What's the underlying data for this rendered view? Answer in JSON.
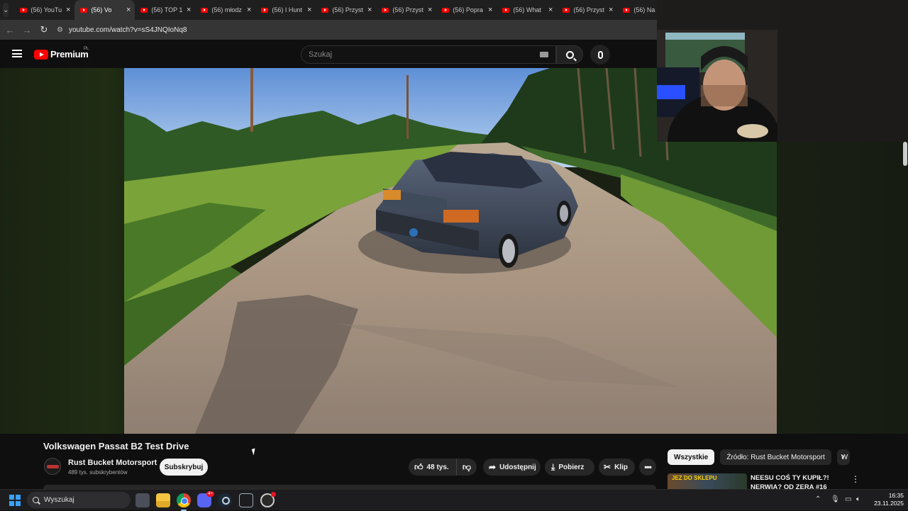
{
  "tabs": [
    {
      "title": "(56) YouTu",
      "active": false
    },
    {
      "title": "(56) Vo",
      "active": true
    },
    {
      "title": "(56) TOP 1",
      "active": false
    },
    {
      "title": "(56) młodz",
      "active": false
    },
    {
      "title": "(56) I Hunt",
      "active": false
    },
    {
      "title": "(56) Przyst",
      "active": false
    },
    {
      "title": "(56) Przyst",
      "active": false
    },
    {
      "title": "(56) Popra",
      "active": false
    },
    {
      "title": "(56) What",
      "active": false
    },
    {
      "title": "(56) Przyst",
      "active": false
    },
    {
      "title": "(56) Na",
      "active": false
    }
  ],
  "tab_close_glyph": "×",
  "address": {
    "url": "youtube.com/watch?v=sS4JNQIoNq8"
  },
  "youtube": {
    "brand": "Premium",
    "region": "PL",
    "search_placeholder": "Szukaj"
  },
  "video": {
    "title": "Volkswagen Passat B2 Test Drive",
    "channel": "Rust Bucket Motorsport",
    "subscribers": "489 tys. subskrybentów",
    "subscribe_label": "Subskrybuj",
    "likes": "48 tys.",
    "share_label": "Udostępnij",
    "download_label": "Pobierz",
    "clip_label": "Klip",
    "more_label": "•••"
  },
  "sidebar": {
    "chips": [
      "Wszystkie",
      "Źródło: Rust Bucket Motorsport",
      "W"
    ],
    "next_glyph": "›",
    "recommendation": {
      "title": "NEESU COŚ TY KUPIŁ?! NERWIA? OD ZERA #16",
      "thumb_label": "JEZ DO SKLEPU",
      "more_glyph": "⋮"
    }
  },
  "taskbar": {
    "search_placeholder": "Wyszukaj",
    "discord_badge": "4+",
    "time": "16:35",
    "date": "23.11.2025"
  },
  "icons": {
    "like": "thumbs-up-icon",
    "dislike": "thumbs-down-icon",
    "share": "share-arrow-icon",
    "download": "download-icon",
    "clip": "scissors-icon"
  },
  "colors": {
    "yt_red": "#ff0000",
    "bg": "#0f0f0f",
    "pill": "#272727"
  }
}
